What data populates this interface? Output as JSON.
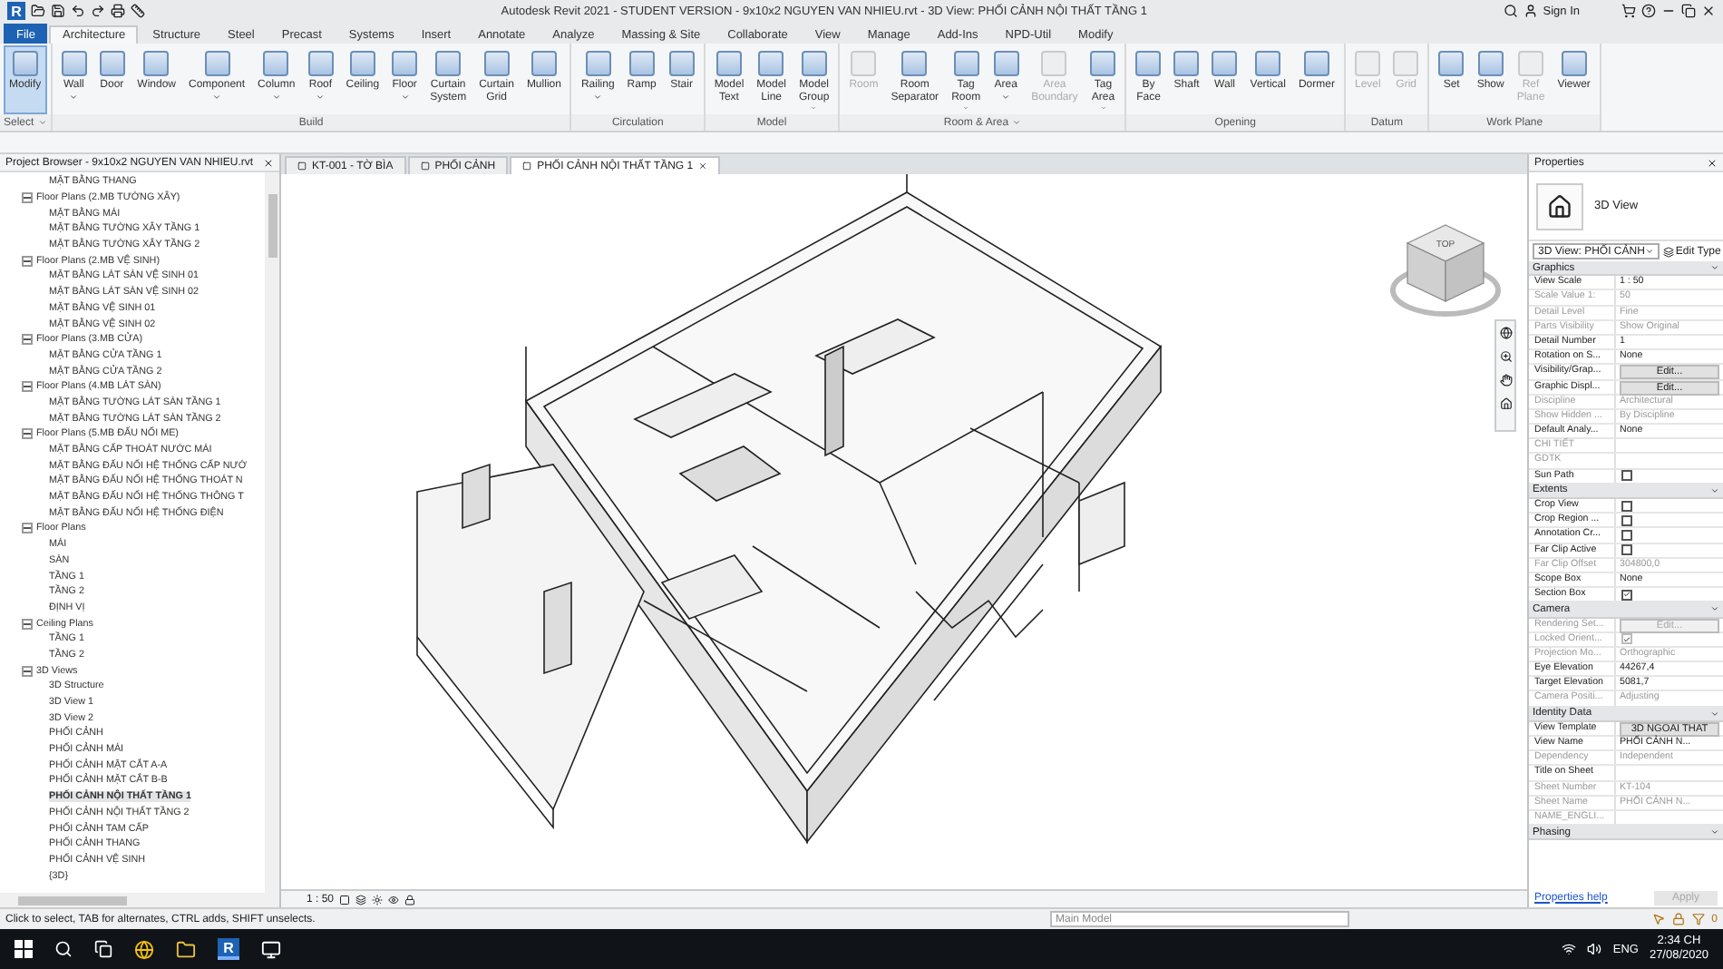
{
  "title_bar": {
    "logo": "R",
    "title": "Autodesk Revit 2021 - STUDENT VERSION - 9x10x2 NGUYEN VAN NHIEU.rvt - 3D View: PHỐI CẢNH NỘI THẤT TẦNG 1",
    "sign_in": "Sign In"
  },
  "ribbon": {
    "tabs": [
      {
        "label": "File",
        "kind": "application",
        "selected": false
      },
      {
        "label": "Architecture",
        "kind": "tab",
        "selected": true
      },
      {
        "label": "Structure",
        "kind": "tab",
        "selected": false
      },
      {
        "label": "Steel",
        "kind": "tab",
        "selected": false
      },
      {
        "label": "Precast",
        "kind": "tab",
        "selected": false
      },
      {
        "label": "Systems",
        "kind": "tab",
        "selected": false
      },
      {
        "label": "Insert",
        "kind": "tab",
        "selected": false
      },
      {
        "label": "Annotate",
        "kind": "tab",
        "selected": false
      },
      {
        "label": "Analyze",
        "kind": "tab",
        "selected": false
      },
      {
        "label": "Massing & Site",
        "kind": "tab",
        "selected": false
      },
      {
        "label": "Collaborate",
        "kind": "tab",
        "selected": false
      },
      {
        "label": "View",
        "kind": "tab",
        "selected": false
      },
      {
        "label": "Manage",
        "kind": "tab",
        "selected": false
      },
      {
        "label": "Add-Ins",
        "kind": "tab",
        "selected": false
      },
      {
        "label": "NPD-Util",
        "kind": "tab",
        "selected": false
      },
      {
        "label": "Modify",
        "kind": "tab",
        "selected": false
      }
    ],
    "panels": [
      {
        "label": "Select",
        "menu": true,
        "tools": [
          {
            "label": "Modify",
            "selected": true,
            "disabled": false,
            "menu": false
          }
        ]
      },
      {
        "label": "Build",
        "menu": false,
        "tools": [
          {
            "label": "Wall",
            "selected": false,
            "disabled": false,
            "menu": true
          },
          {
            "label": "Door",
            "selected": false,
            "disabled": false,
            "menu": false
          },
          {
            "label": "Window",
            "selected": false,
            "disabled": false,
            "menu": false
          },
          {
            "label": "Component",
            "selected": false,
            "disabled": false,
            "menu": true
          },
          {
            "label": "Column",
            "selected": false,
            "disabled": false,
            "menu": true
          },
          {
            "label": "Roof",
            "selected": false,
            "disabled": false,
            "menu": true
          },
          {
            "label": "Ceiling",
            "selected": false,
            "disabled": false,
            "menu": false
          },
          {
            "label": "Floor",
            "selected": false,
            "disabled": false,
            "menu": true
          },
          {
            "label": "Curtain\nSystem",
            "selected": false,
            "disabled": false,
            "menu": false
          },
          {
            "label": "Curtain\nGrid",
            "selected": false,
            "disabled": false,
            "menu": false
          },
          {
            "label": "Mullion",
            "selected": false,
            "disabled": false,
            "menu": false
          }
        ]
      },
      {
        "label": "Circulation",
        "menu": false,
        "tools": [
          {
            "label": "Railing",
            "selected": false,
            "disabled": false,
            "menu": true
          },
          {
            "label": "Ramp",
            "selected": false,
            "disabled": false,
            "menu": false
          },
          {
            "label": "Stair",
            "selected": false,
            "disabled": false,
            "menu": false
          }
        ]
      },
      {
        "label": "Model",
        "menu": false,
        "tools": [
          {
            "label": "Model\nText",
            "selected": false,
            "disabled": false,
            "menu": false
          },
          {
            "label": "Model\nLine",
            "selected": false,
            "disabled": false,
            "menu": false
          },
          {
            "label": "Model\nGroup",
            "selected": false,
            "disabled": false,
            "menu": true
          }
        ]
      },
      {
        "label": "Room & Area",
        "menu": true,
        "tools": [
          {
            "label": "Room",
            "selected": false,
            "disabled": true,
            "menu": false
          },
          {
            "label": "Room\nSeparator",
            "selected": false,
            "disabled": false,
            "menu": false
          },
          {
            "label": "Tag\nRoom",
            "selected": false,
            "disabled": false,
            "menu": true
          },
          {
            "label": "Area",
            "selected": false,
            "disabled": false,
            "menu": true
          },
          {
            "label": "Area\nBoundary",
            "selected": false,
            "disabled": true,
            "menu": false
          },
          {
            "label": "Tag\nArea",
            "selected": false,
            "disabled": false,
            "menu": true
          }
        ]
      },
      {
        "label": "Opening",
        "menu": false,
        "tools": [
          {
            "label": "By\nFace",
            "selected": false,
            "disabled": false,
            "menu": false
          },
          {
            "label": "Shaft",
            "selected": false,
            "disabled": false,
            "menu": false
          },
          {
            "label": "Wall",
            "selected": false,
            "disabled": false,
            "menu": false
          },
          {
            "label": "Vertical",
            "selected": false,
            "disabled": false,
            "menu": false
          },
          {
            "label": "Dormer",
            "selected": false,
            "disabled": false,
            "menu": false
          }
        ]
      },
      {
        "label": "Datum",
        "menu": false,
        "tools": [
          {
            "label": "Level",
            "selected": false,
            "disabled": true,
            "menu": false
          },
          {
            "label": "Grid",
            "selected": false,
            "disabled": true,
            "menu": false
          }
        ]
      },
      {
        "label": "Work Plane",
        "menu": false,
        "tools": [
          {
            "label": "Set",
            "selected": false,
            "disabled": false,
            "menu": false
          },
          {
            "label": "Show",
            "selected": false,
            "disabled": false,
            "menu": false
          },
          {
            "label": "Ref\nPlane",
            "selected": false,
            "disabled": true,
            "menu": false
          },
          {
            "label": "Viewer",
            "selected": false,
            "disabled": false,
            "menu": false
          }
        ]
      }
    ]
  },
  "browser": {
    "title": "Project Browser - 9x10x2 NGUYEN VAN NHIEU.rvt",
    "tree": [
      {
        "label": "MẶT BẰNG THANG",
        "kind": "view",
        "selected": false
      },
      {
        "label": "Floor Plans (2.MB TƯỜNG XÂY)",
        "kind": "group",
        "expanded": true,
        "children": [
          {
            "label": "MẶT BẰNG MÁI",
            "kind": "view",
            "selected": false
          },
          {
            "label": "MẶT BẰNG TƯỜNG XÂY TẦNG 1",
            "kind": "view",
            "selected": false
          },
          {
            "label": "MẶT BẰNG TƯỜNG XÂY TẦNG 2",
            "kind": "view",
            "selected": false
          }
        ]
      },
      {
        "label": "Floor Plans (2.MB VỆ SINH)",
        "kind": "group",
        "expanded": true,
        "children": [
          {
            "label": "MẶT BẰNG LÁT SÀN VỆ SINH 01",
            "kind": "view",
            "selected": false
          },
          {
            "label": "MẶT BẰNG LÁT SÀN VỆ SINH 02",
            "kind": "view",
            "selected": false
          },
          {
            "label": "MẶT BẰNG VỆ SINH 01",
            "kind": "view",
            "selected": false
          },
          {
            "label": "MẶT BẰNG VỆ SINH 02",
            "kind": "view",
            "selected": false
          }
        ]
      },
      {
        "label": "Floor Plans (3.MB CỬA)",
        "kind": "group",
        "expanded": true,
        "children": [
          {
            "label": "MẶT BẰNG CỬA TẦNG 1",
            "kind": "view",
            "selected": false
          },
          {
            "label": "MẶT BẰNG CỬA TẦNG 2",
            "kind": "view",
            "selected": false
          }
        ]
      },
      {
        "label": "Floor Plans (4.MB LÁT SÀN)",
        "kind": "group",
        "expanded": true,
        "children": [
          {
            "label": "MẶT BẰNG TƯỜNG LÁT SÀN TẦNG 1",
            "kind": "view",
            "selected": false
          },
          {
            "label": "MẶT BẰNG TƯỜNG LÁT SÀN TẦNG 2",
            "kind": "view",
            "selected": false
          }
        ]
      },
      {
        "label": "Floor Plans (5.MB ĐẤU NỐI ME)",
        "kind": "group",
        "expanded": true,
        "children": [
          {
            "label": "MẶT BẰNG CẤP THOÁT NƯỚC MÁI",
            "kind": "view",
            "selected": false
          },
          {
            "label": "MẶT BẰNG ĐẤU NỐI HỆ THỐNG CẤP NƯỚ",
            "kind": "view",
            "selected": false
          },
          {
            "label": "MẶT BẰNG ĐẤU NỐI HỆ THỐNG THOÁT N",
            "kind": "view",
            "selected": false
          },
          {
            "label": "MẶT BẰNG ĐẤU NỐI HỆ THỐNG THÔNG T",
            "kind": "view",
            "selected": false
          },
          {
            "label": "MẶT BẰNG ĐẤU NỐI HỆ THỐNG ĐIỆN",
            "kind": "view",
            "selected": false
          }
        ]
      },
      {
        "label": "Floor Plans",
        "kind": "group",
        "expanded": true,
        "children": [
          {
            "label": "MÁI",
            "kind": "view",
            "selected": false
          },
          {
            "label": "SÀN",
            "kind": "view",
            "selected": false
          },
          {
            "label": "TẦNG 1",
            "kind": "view",
            "selected": false
          },
          {
            "label": "TẦNG 2",
            "kind": "view",
            "selected": false
          },
          {
            "label": "ĐỊNH VỊ",
            "kind": "view",
            "selected": false
          }
        ]
      },
      {
        "label": "Ceiling Plans",
        "kind": "group",
        "expanded": true,
        "children": [
          {
            "label": "TẦNG 1",
            "kind": "view",
            "selected": false
          },
          {
            "label": "TẦNG 2",
            "kind": "view",
            "selected": false
          }
        ]
      },
      {
        "label": "3D Views",
        "kind": "group",
        "expanded": true,
        "children": [
          {
            "label": "3D Structure",
            "kind": "view",
            "selected": false
          },
          {
            "label": "3D View 1",
            "kind": "view",
            "selected": false
          },
          {
            "label": "3D View 2",
            "kind": "view",
            "selected": false
          },
          {
            "label": "PHỐI CẢNH",
            "kind": "view",
            "selected": false
          },
          {
            "label": "PHỐI CẢNH MÁI",
            "kind": "view",
            "selected": false
          },
          {
            "label": "PHỐI CẢNH MẶT CẮT A-A",
            "kind": "view",
            "selected": false
          },
          {
            "label": "PHỐI CẢNH MẶT CẮT B-B",
            "kind": "view",
            "selected": false
          },
          {
            "label": "PHỐI CẢNH NỘI THẤT TẦNG 1",
            "kind": "view",
            "selected": true
          },
          {
            "label": "PHỐI CẢNH NỘI THẤT TẦNG 2",
            "kind": "view",
            "selected": false
          },
          {
            "label": "PHỐI CẢNH TAM CẤP",
            "kind": "view",
            "selected": false
          },
          {
            "label": "PHỐI CẢNH THANG",
            "kind": "view",
            "selected": false
          },
          {
            "label": "PHỐI CẢNH VỆ SINH",
            "kind": "view",
            "selected": false
          },
          {
            "label": "{3D}",
            "kind": "view",
            "selected": false
          }
        ]
      }
    ]
  },
  "view_tabs": [
    {
      "label": "KT-001 - TỜ BÌA",
      "selected": false
    },
    {
      "label": "PHỐI CẢNH",
      "selected": false
    },
    {
      "label": "PHỐI CẢNH NỘI THẤT TẦNG 1",
      "selected": true
    }
  ],
  "view_cube": {
    "face": "TOP"
  },
  "view_control": {
    "scale": "1 : 50"
  },
  "properties": {
    "title": "Properties",
    "type_name": "3D View",
    "view_selector": "3D View: PHỐI CẢNH",
    "edit_type": "Edit Type",
    "sections": [
      {
        "title": "Graphics",
        "rows": [
          {
            "label": "View Scale",
            "value": "1 : 50",
            "kind": "text",
            "disabled": false
          },
          {
            "label": "Scale Value    1:",
            "value": "50",
            "kind": "text",
            "disabled": true
          },
          {
            "label": "Detail Level",
            "value": "Fine",
            "kind": "text",
            "disabled": true
          },
          {
            "label": "Parts Visibility",
            "value": "Show Original",
            "kind": "text",
            "disabled": true
          },
          {
            "label": "Detail Number",
            "value": "1",
            "kind": "text",
            "disabled": false
          },
          {
            "label": "Rotation on S...",
            "value": "None",
            "kind": "text",
            "disabled": false
          },
          {
            "label": "Visibility/Grap...",
            "value": "Edit...",
            "kind": "button",
            "disabled": false
          },
          {
            "label": "Graphic Displ...",
            "value": "Edit...",
            "kind": "button",
            "disabled": false
          },
          {
            "label": "Discipline",
            "value": "Architectural",
            "kind": "text",
            "disabled": true
          },
          {
            "label": "Show Hidden ...",
            "value": "By Discipline",
            "kind": "text",
            "disabled": true
          },
          {
            "label": "Default Analy...",
            "value": "None",
            "kind": "text",
            "disabled": false
          },
          {
            "label": "CHI TIẾT",
            "kind": "text",
            "disabled": true
          },
          {
            "label": "GDTK",
            "kind": "text",
            "disabled": true
          },
          {
            "label": "Sun Path",
            "kind": "checkbox",
            "checked": false,
            "disabled": false
          }
        ]
      },
      {
        "title": "Extents",
        "rows": [
          {
            "label": "Crop View",
            "kind": "checkbox",
            "checked": false,
            "disabled": false
          },
          {
            "label": "Crop Region ...",
            "kind": "checkbox",
            "checked": false,
            "disabled": false
          },
          {
            "label": "Annotation Cr...",
            "kind": "checkbox",
            "checked": false,
            "disabled": false
          },
          {
            "label": "Far Clip Active",
            "kind": "checkbox",
            "checked": false,
            "disabled": false
          },
          {
            "label": "Far Clip Offset",
            "value": "304800,0",
            "kind": "text",
            "disabled": true
          },
          {
            "label": "Scope Box",
            "value": "None",
            "kind": "text",
            "disabled": false
          },
          {
            "label": "Section Box",
            "kind": "checkbox",
            "checked": true,
            "disabled": false
          }
        ]
      },
      {
        "title": "Camera",
        "rows": [
          {
            "label": "Rendering Set...",
            "value": "Edit...",
            "kind": "button",
            "disabled": true
          },
          {
            "label": "Locked Orient...",
            "kind": "checkbox",
            "checked": true,
            "disabled": true
          },
          {
            "label": "Projection Mo...",
            "value": "Orthographic",
            "kind": "text",
            "disabled": true
          },
          {
            "label": "Eye Elevation",
            "value": "44267,4",
            "kind": "text",
            "disabled": false
          },
          {
            "label": "Target Elevation",
            "value": "5081,7",
            "kind": "text",
            "disabled": false
          },
          {
            "label": "Camera Positi...",
            "value": "Adjusting",
            "kind": "text",
            "disabled": true
          }
        ]
      },
      {
        "title": "Identity Data",
        "rows": [
          {
            "label": "View Template",
            "value": "3D NGOAI THAT",
            "kind": "button",
            "disabled": false
          },
          {
            "label": "View Name",
            "value": "PHỐI CẢNH N...",
            "kind": "text",
            "disabled": false
          },
          {
            "label": "Dependency",
            "value": "Independent",
            "kind": "text",
            "disabled": true
          },
          {
            "label": "Title on Sheet",
            "kind": "text",
            "disabled": false
          },
          {
            "label": "Sheet Number",
            "value": "KT-104",
            "kind": "text",
            "disabled": true
          },
          {
            "label": "Sheet Name",
            "value": "PHỐI CẢNH N...",
            "kind": "text",
            "disabled": true
          },
          {
            "label": "NAME_ENGLI...",
            "kind": "text",
            "disabled": true
          }
        ]
      },
      {
        "title": "Phasing"
      }
    ],
    "help": "Properties help",
    "apply": "Apply"
  },
  "status_bar": {
    "message": "Click to select, TAB for alternates, CTRL adds, SHIFT unselects.",
    "model": "Main Model",
    "filter_count": "0"
  },
  "taskbar": {
    "revit": "R",
    "language": "ENG",
    "time": "2:34 CH",
    "date": "27/08/2020"
  }
}
